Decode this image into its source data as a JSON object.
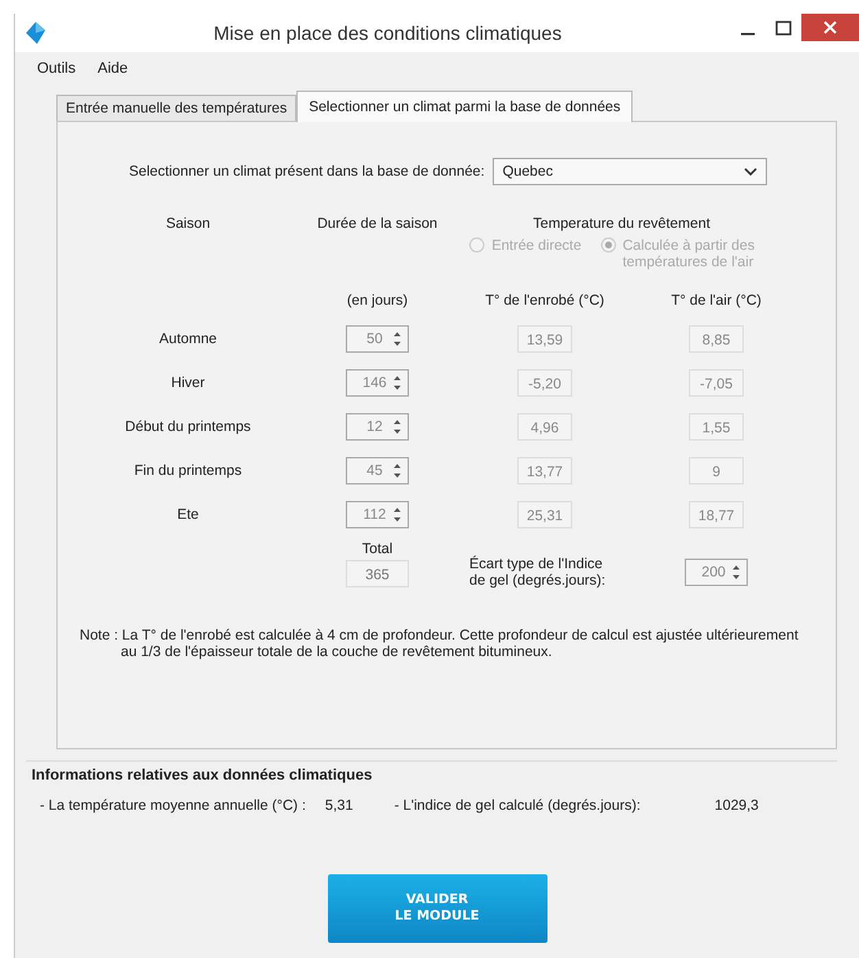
{
  "window": {
    "title": "Mise en place des conditions climatiques"
  },
  "menu": [
    "Outils",
    "Aide"
  ],
  "tabs": [
    {
      "label": "Entrée manuelle des températures",
      "selected": false
    },
    {
      "label": "Selectionner un climat parmi la base de données",
      "selected": true
    }
  ],
  "climate_select": {
    "label": "Selectionner un climat présent dans la base de donnée:",
    "value": "Quebec"
  },
  "headers": {
    "season": "Saison",
    "duration": "Durée de la saison",
    "pavement": "Temperature du revêtement",
    "duration_unit": "(en jours)",
    "asphalt_temp": "T° de l'enrobé (°C)",
    "air_temp": "T° de l'air (°C)"
  },
  "radios": [
    {
      "label": "Entrée directe",
      "selected": false,
      "disabled": true
    },
    {
      "label": "Calculée à partir des températures de l'air",
      "selected": true,
      "disabled": true
    }
  ],
  "seasons": [
    {
      "name": "Automne",
      "days": "50",
      "asphalt_temp": "13,59",
      "air_temp": "8,85"
    },
    {
      "name": "Hiver",
      "days": "146",
      "asphalt_temp": "-5,20",
      "air_temp": "-7,05"
    },
    {
      "name": "Début du printemps",
      "days": "12",
      "asphalt_temp": "4,96",
      "air_temp": "1,55"
    },
    {
      "name": "Fin du printemps",
      "days": "45",
      "asphalt_temp": "13,77",
      "air_temp": "9"
    },
    {
      "name": "Ete",
      "days": "112",
      "asphalt_temp": "25,31",
      "air_temp": "18,77"
    }
  ],
  "total": {
    "label": "Total",
    "value": "365"
  },
  "frost_std": {
    "label": "Écart type de l'Indice de gel (degrés.jours):",
    "value": "200"
  },
  "note": "Note : La T° de l'enrobé est calculée à 4 cm de profondeur. Cette profondeur de calcul est ajustée ultérieurement au 1/3 de l'épaisseur totale de la couche de revêtement bitumineux.",
  "info": {
    "title": "Informations relatives aux données climatiques",
    "items": [
      {
        "label": "- La température moyenne annuelle (°C) :",
        "value": "5,31"
      },
      {
        "label": "- L'indice de gel calculé (degrés.jours):",
        "value": "1029,3"
      }
    ]
  },
  "submit_button": "VALIDER\nLE MODULE"
}
